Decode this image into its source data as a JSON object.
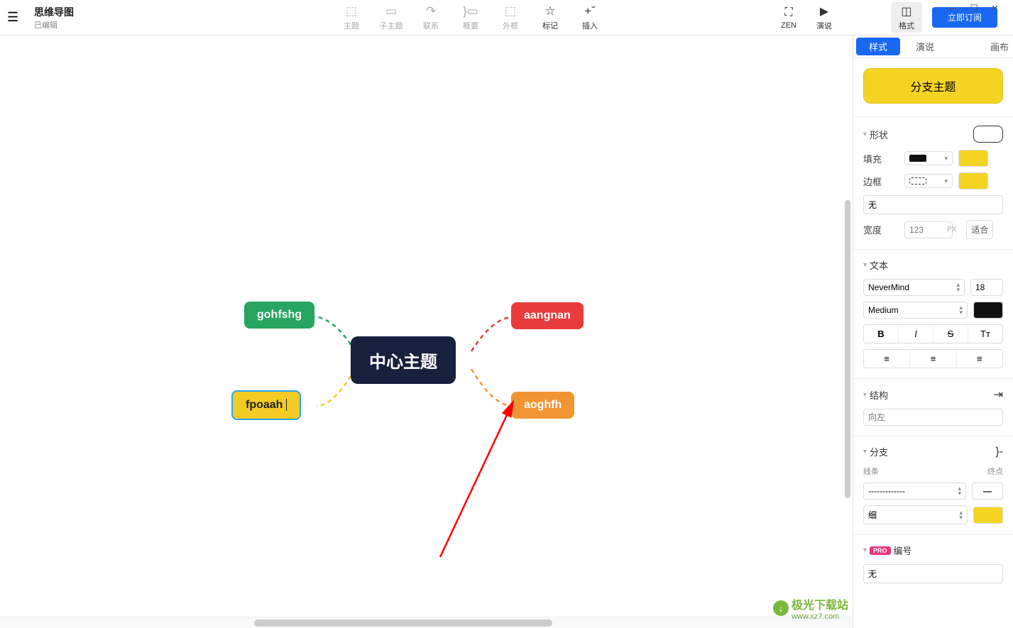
{
  "header": {
    "title": "思维导图",
    "subtitle": "已编辑"
  },
  "toolbar": {
    "topic": "主题",
    "subtopic": "子主题",
    "relation": "联系",
    "summary": "概要",
    "boundary": "外框",
    "marker": "标记",
    "insert": "插入",
    "zen": "ZEN",
    "present": "演说",
    "format": "格式",
    "subscribe": "立即订阅"
  },
  "mindmap": {
    "center": "中心主题",
    "green": "gohfshg",
    "red": "aangnan",
    "orange": "aoghfh",
    "yellow": "fpoaah"
  },
  "panel": {
    "tabs": {
      "style": "样式",
      "present": "演说",
      "canvas": "画布"
    },
    "branch_topic": "分支主题",
    "shape": {
      "label": "形状",
      "fill": "填充",
      "border": "边框",
      "none": "无",
      "width_label": "宽度",
      "width_placeholder": "123",
      "width_unit": "PX",
      "fit": "适合"
    },
    "text": {
      "label": "文本",
      "font": "NeverMind",
      "size": "18",
      "weight": "Medium",
      "bold": "B",
      "italic": "I",
      "strike": "S",
      "case": "Tᴛ"
    },
    "structure": {
      "label": "结构",
      "direction_placeholder": "向左"
    },
    "branch": {
      "label": "分支",
      "line": "线条",
      "endpoint": "终点",
      "dash": "-------------",
      "thin": "细"
    },
    "numbering": {
      "label": "编号",
      "none": "无"
    }
  },
  "watermark": {
    "text": "极光下载站",
    "url": "www.xz7.com"
  }
}
